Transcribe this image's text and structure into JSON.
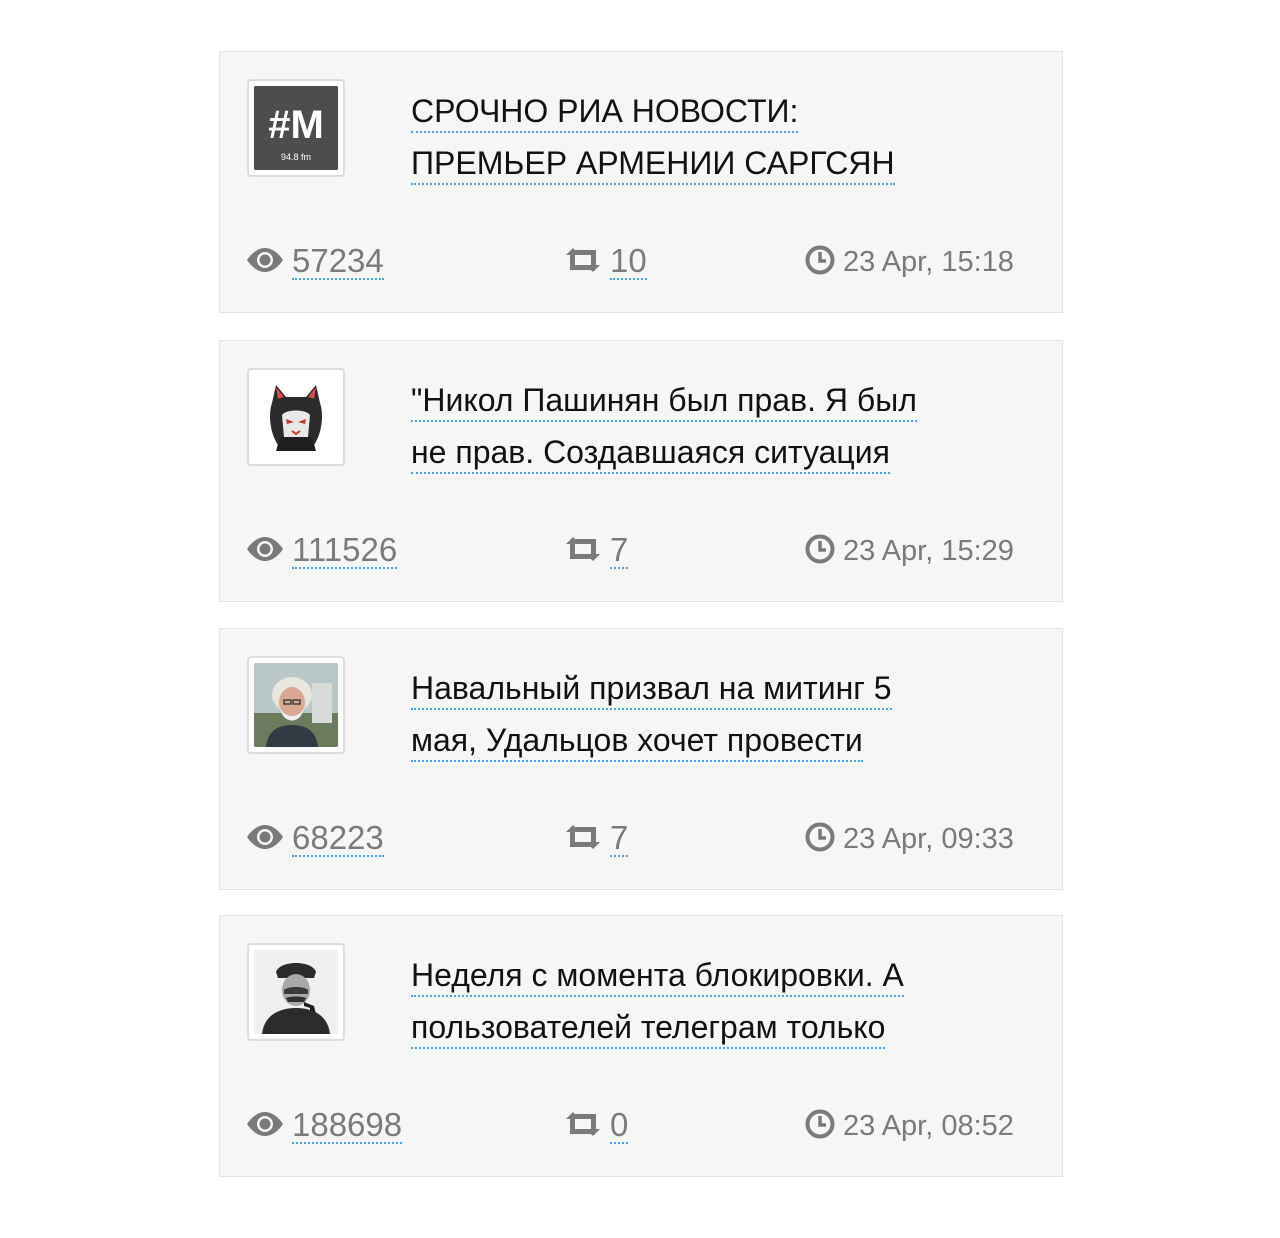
{
  "posts": [
    {
      "avatar_icon": "radio-m-logo-icon",
      "avatar_label": "#M",
      "avatar_sublabel": "94.8 fm",
      "title_line1": "СРОЧНО РИА НОВОСТИ:",
      "title_line2": "ПРЕМЬЕР АРМЕНИИ САРГСЯН",
      "views": "57234",
      "reposts": "10",
      "date": "23 Apr, 15:18"
    },
    {
      "avatar_icon": "hooded-cat-icon",
      "title_line1": "\"Никол Пашинян был прав. Я был",
      "title_line2": "не прав. Создавшаяся ситуация",
      "views": "111526",
      "reposts": "7",
      "date": "23 Apr, 15:29"
    },
    {
      "avatar_icon": "bearded-man-photo-icon",
      "title_line1": "Навальный призвал на митинг 5",
      "title_line2": "мая, Удальцов хочет провести",
      "views": "68223",
      "reposts": "7",
      "date": "23 Apr, 09:33"
    },
    {
      "avatar_icon": "man-with-pipe-photo-icon",
      "title_line1": "Неделя с момента блокировки. А",
      "title_line2": "пользователей телеграм только",
      "views": "188698",
      "reposts": "0",
      "date": "23 Apr, 08:52"
    }
  ],
  "colors": {
    "card_bg": "#f6f6f6",
    "link_underline": "#4aa3df",
    "meta_text": "#7a7a7a"
  }
}
